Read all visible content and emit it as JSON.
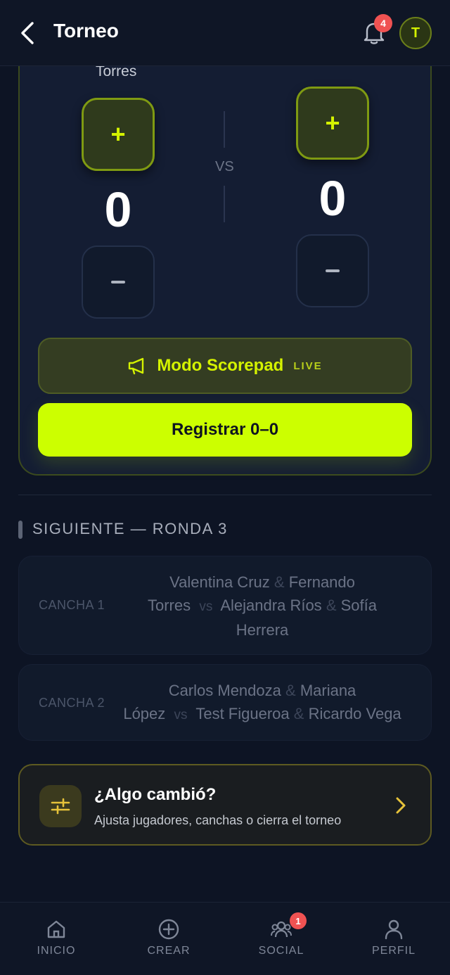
{
  "header": {
    "title": "Torneo",
    "notification_count": "4",
    "avatar_initial": "T"
  },
  "scoreboard": {
    "team_a_name_partial": "Torres",
    "team_a_score": "0",
    "team_b_score": "0",
    "vs": "VS",
    "plus": "+",
    "modo_label": "Modo Scorepad",
    "live_tag": "LIVE",
    "register_label": "Registrar 0–0"
  },
  "next_section": {
    "title": "SIGUIENTE — RONDA 3",
    "matches": [
      {
        "court": "CANCHA 1",
        "line1": "Valentina Cruz",
        "line1_partner": "Fernando",
        "line2_a": "Torres",
        "vs": "vs",
        "line2_b": "Alejandra Ríos",
        "line2_partner": "Sofía",
        "line3": "Herrera"
      },
      {
        "court": "CANCHA 2",
        "line1": "Carlos Mendoza",
        "line1_partner": "Mariana",
        "line2_a": "López",
        "vs": "vs",
        "line2_b": "Test Figueroa",
        "line2_partner": "Ricardo Vega"
      }
    ],
    "amp": "&"
  },
  "info_card": {
    "title": "¿Algo cambió?",
    "subtitle": "Ajusta jugadores, canchas o cierra el torneo"
  },
  "bottom_nav": {
    "items": [
      {
        "label": "INICIO",
        "icon": "home-icon"
      },
      {
        "label": "CREAR",
        "icon": "plus-circle-icon"
      },
      {
        "label": "SOCIAL",
        "icon": "people-icon",
        "badge": "1"
      },
      {
        "label": "PERFIL",
        "icon": "person-icon"
      }
    ]
  },
  "colors": {
    "background": "#0d1424",
    "accent": "#ccff00",
    "badge": "#f05252"
  }
}
